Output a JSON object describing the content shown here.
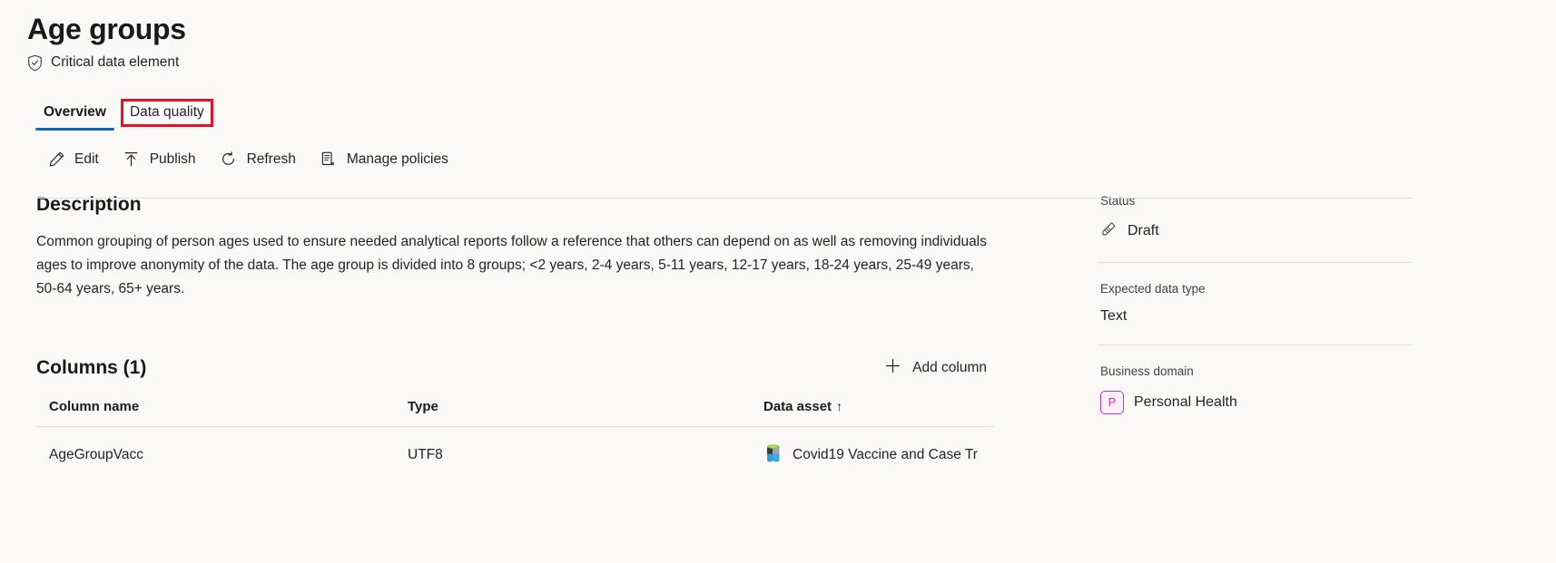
{
  "header": {
    "title": "Age groups",
    "badge_label": "Critical data element",
    "badge_icon": "shield-check-icon"
  },
  "tabs": [
    {
      "label": "Overview",
      "active": true,
      "highlighted": false
    },
    {
      "label": "Data quality",
      "active": false,
      "highlighted": true
    }
  ],
  "commands": [
    {
      "label": "Edit",
      "icon": "pencil-icon"
    },
    {
      "label": "Publish",
      "icon": "upload-arrow-icon"
    },
    {
      "label": "Refresh",
      "icon": "refresh-icon"
    },
    {
      "label": "Manage policies",
      "icon": "policy-document-icon"
    }
  ],
  "description": {
    "heading": "Description",
    "text": "Common grouping of person ages used to ensure needed analytical reports follow a reference that others can depend on as well as removing individuals ages to improve anonymity of the data. The age group is divided into 8 groups; <2 years, 2-4 years, 5-11 years, 12-17 years, 18-24 years, 25-49 years, 50-64 years, 65+ years."
  },
  "columns_section": {
    "heading": "Columns (1)",
    "add_button": "Add column",
    "add_icon": "plus-icon",
    "table": {
      "headers": [
        "Column name",
        "Type",
        "Data asset"
      ],
      "sorted_header": "Data asset",
      "sort_direction": "↑",
      "rows": [
        {
          "column_name": "AgeGroupVacc",
          "type": "UTF8",
          "data_asset": "Covid19 Vaccine and Case Tr",
          "data_asset_icon": "database-asset-icon"
        }
      ]
    }
  },
  "side_panel": [
    {
      "label": "Status",
      "value": "Draft",
      "icon": "draft-pencil-icon"
    },
    {
      "label": "Expected data type",
      "value": "Text",
      "icon": ""
    },
    {
      "label": "Business domain",
      "value": "Personal Health",
      "icon": "domain-initial-chip",
      "initial": "P"
    }
  ],
  "colors": {
    "accent": "#0f6cbd",
    "highlight": "#e81123",
    "domain_chip": "#c239b3",
    "page_bg": "#faf9f8"
  }
}
